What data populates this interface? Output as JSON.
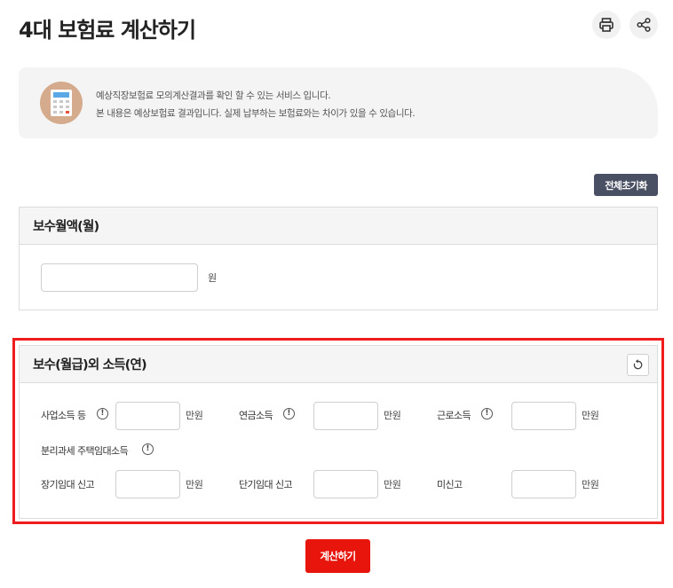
{
  "page": {
    "title": "4대 보험료 계산하기"
  },
  "toolbar": {
    "print_icon": "printer-icon",
    "share_icon": "share-icon"
  },
  "notice": {
    "icon": "calculator-icon",
    "line1": "예상직장보험료 모의계산결과를 확인 할 수 있는 서비스 입니다.",
    "line2": "본 내용은 예상보험료 결과입니다. 실제 납부하는 보험료와는 차이가 있을 수 있습니다."
  },
  "reset_all_label": "전체초기화",
  "salary": {
    "title": "보수월액(월)",
    "value": "",
    "unit": "원"
  },
  "income": {
    "title": "보수(월급)외 소득(연)",
    "reset_icon": "refresh-icon",
    "info_glyph": "!",
    "fields": [
      {
        "label": "사업소득 등",
        "value": "",
        "unit": "만원"
      },
      {
        "label": "연금소득",
        "value": "",
        "unit": "만원"
      },
      {
        "label": "근로소득",
        "value": "",
        "unit": "만원"
      }
    ],
    "rental_label": "분리과세 주택임대소득",
    "rental_fields": [
      {
        "label": "장기임대 신고",
        "value": "",
        "unit": "만원"
      },
      {
        "label": "단기임대 신고",
        "value": "",
        "unit": "만원"
      },
      {
        "label": "미신고",
        "value": "",
        "unit": "만원"
      }
    ]
  },
  "calculate_label": "계산하기",
  "colors": {
    "accent_red": "#e8150c",
    "highlight_red": "#ee1c1c",
    "dark_button": "#4a5063",
    "avatar_bg": "#d4ab8c"
  }
}
